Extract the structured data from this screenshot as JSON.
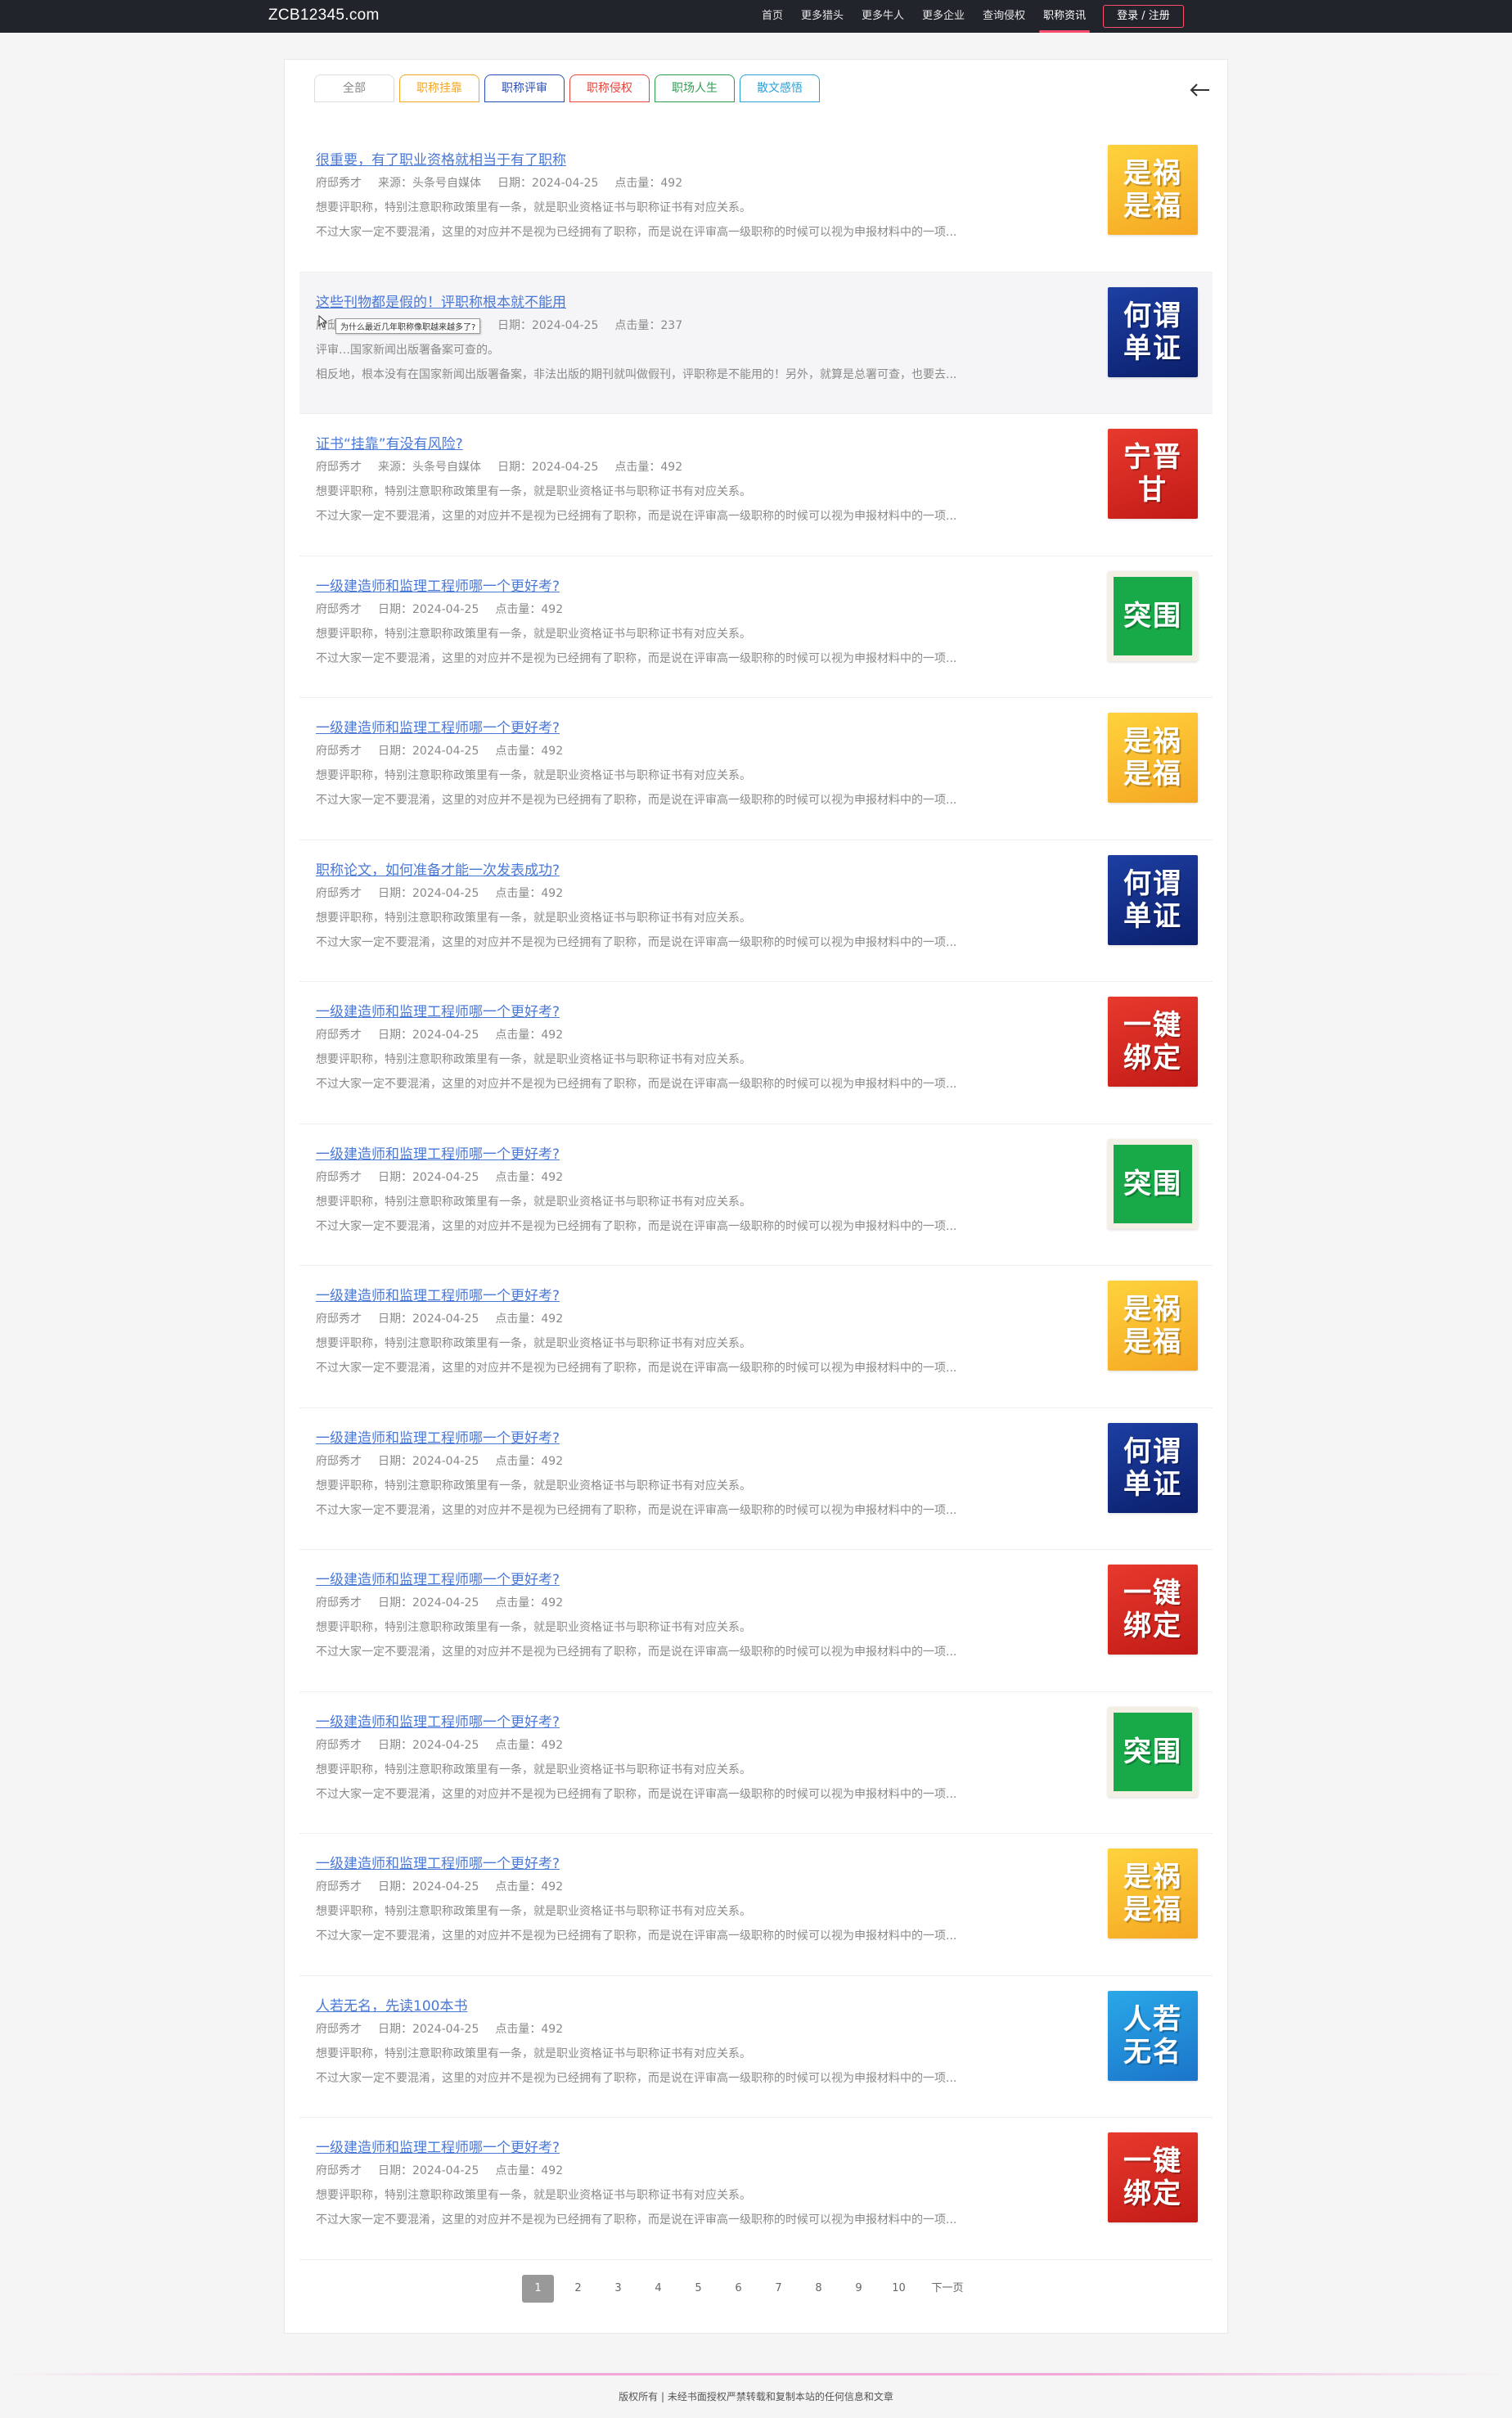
{
  "header": {
    "logo": "ZCB12345.com",
    "nav": [
      "首页",
      "更多猎头",
      "更多牛人",
      "更多企业",
      "查询侵权",
      "职称资讯"
    ],
    "active_nav": "职称资讯",
    "login_label": "登录 / 注册"
  },
  "tabs": [
    {
      "label": "全部",
      "color": "#888888"
    },
    {
      "label": "职称挂靠",
      "color": "#f5a623"
    },
    {
      "label": "职称评审",
      "color": "#2a4db8"
    },
    {
      "label": "职称侵权",
      "color": "#e8453c"
    },
    {
      "label": "职场人生",
      "color": "#2e9e4f"
    },
    {
      "label": "散文感悟",
      "color": "#2aa0d8"
    }
  ],
  "tooltip": "为什么最近几年职称像职越来越多了?",
  "articles": [
    {
      "title": "很重要，有了职业资格就相当于有了职称",
      "author": "府邸秀才",
      "source": "来源：头条号自媒体",
      "date": "日期：2024-04-25",
      "clicks": "点击量：492",
      "desc1": "想要评职称，特别注意职称政策里有一条，就是职业资格证书与职称证书有对应关系。",
      "desc2": "不过大家一定不要混淆，这里的对应并不是视为已经拥有了职称，而是说在评审高一级职称的时候可以视为申报材料中的一项...",
      "thumb_text": "是祸是福",
      "thumb_style": "yellow"
    },
    {
      "title": "这些刊物都是假的！评职称根本就不能用",
      "author": "府邸秀才",
      "source": "来源：头条号自媒体",
      "date": "日期：2024-04-25",
      "clicks": "点击量：237",
      "desc1": "评审…国家新闻出版署备案可查的。",
      "desc2": "相反地，根本没有在国家新闻出版署备案，非法出版的期刊就叫做假刊，评职称是不能用的！另外，就算是总署可查，也要去...",
      "thumb_text": "何谓单证",
      "thumb_style": "navy"
    },
    {
      "title": "证书“挂靠”有没有风险?",
      "author": "府邸秀才",
      "source": "来源：头条号自媒体",
      "date": "日期：2024-04-25",
      "clicks": "点击量：492",
      "desc1": "想要评职称，特别注意职称政策里有一条，就是职业资格证书与职称证书有对应关系。",
      "desc2": "不过大家一定不要混淆，这里的对应并不是视为已经拥有了职称，而是说在评审高一级职称的时候可以视为申报材料中的一项...",
      "thumb_text": "宁晋甘",
      "thumb_style": "red"
    },
    {
      "title": "一级建造师和监理工程师哪一个更好考?",
      "author": "府邸秀才",
      "source": "",
      "date": "日期：2024-04-25",
      "clicks": "点击量：492",
      "desc1": "想要评职称，特别注意职称政策里有一条，就是职业资格证书与职称证书有对应关系。",
      "desc2": "不过大家一定不要混淆，这里的对应并不是视为已经拥有了职称，而是说在评审高一级职称的时候可以视为申报材料中的一项...",
      "thumb_text": "突围",
      "thumb_style": "green"
    },
    {
      "title": "一级建造师和监理工程师哪一个更好考?",
      "author": "府邸秀才",
      "source": "",
      "date": "日期：2024-04-25",
      "clicks": "点击量：492",
      "desc1": "想要评职称，特别注意职称政策里有一条，就是职业资格证书与职称证书有对应关系。",
      "desc2": "不过大家一定不要混淆，这里的对应并不是视为已经拥有了职称，而是说在评审高一级职称的时候可以视为申报材料中的一项...",
      "thumb_text": "是祸是福",
      "thumb_style": "yellow"
    },
    {
      "title": "职称论文，如何准备才能一次发表成功?",
      "author": "府邸秀才",
      "source": "",
      "date": "日期：2024-04-25",
      "clicks": "点击量：492",
      "desc1": "想要评职称，特别注意职称政策里有一条，就是职业资格证书与职称证书有对应关系。",
      "desc2": "不过大家一定不要混淆，这里的对应并不是视为已经拥有了职称，而是说在评审高一级职称的时候可以视为申报材料中的一项...",
      "thumb_text": "何谓单证",
      "thumb_style": "navy"
    },
    {
      "title": "一级建造师和监理工程师哪一个更好考?",
      "author": "府邸秀才",
      "source": "",
      "date": "日期：2024-04-25",
      "clicks": "点击量：492",
      "desc1": "想要评职称，特别注意职称政策里有一条，就是职业资格证书与职称证书有对应关系。",
      "desc2": "不过大家一定不要混淆，这里的对应并不是视为已经拥有了职称，而是说在评审高一级职称的时候可以视为申报材料中的一项...",
      "thumb_text": "一键绑定",
      "thumb_style": "red"
    },
    {
      "title": "一级建造师和监理工程师哪一个更好考?",
      "author": "府邸秀才",
      "source": "",
      "date": "日期：2024-04-25",
      "clicks": "点击量：492",
      "desc1": "想要评职称，特别注意职称政策里有一条，就是职业资格证书与职称证书有对应关系。",
      "desc2": "不过大家一定不要混淆，这里的对应并不是视为已经拥有了职称，而是说在评审高一级职称的时候可以视为申报材料中的一项...",
      "thumb_text": "突围",
      "thumb_style": "green"
    },
    {
      "title": "一级建造师和监理工程师哪一个更好考?",
      "author": "府邸秀才",
      "source": "",
      "date": "日期：2024-04-25",
      "clicks": "点击量：492",
      "desc1": "想要评职称，特别注意职称政策里有一条，就是职业资格证书与职称证书有对应关系。",
      "desc2": "不过大家一定不要混淆，这里的对应并不是视为已经拥有了职称，而是说在评审高一级职称的时候可以视为申报材料中的一项...",
      "thumb_text": "是祸是福",
      "thumb_style": "yellow"
    },
    {
      "title": "一级建造师和监理工程师哪一个更好考?",
      "author": "府邸秀才",
      "source": "",
      "date": "日期：2024-04-25",
      "clicks": "点击量：492",
      "desc1": "想要评职称，特别注意职称政策里有一条，就是职业资格证书与职称证书有对应关系。",
      "desc2": "不过大家一定不要混淆，这里的对应并不是视为已经拥有了职称，而是说在评审高一级职称的时候可以视为申报材料中的一项...",
      "thumb_text": "何谓单证",
      "thumb_style": "navy"
    },
    {
      "title": "一级建造师和监理工程师哪一个更好考?",
      "author": "府邸秀才",
      "source": "",
      "date": "日期：2024-04-25",
      "clicks": "点击量：492",
      "desc1": "想要评职称，特别注意职称政策里有一条，就是职业资格证书与职称证书有对应关系。",
      "desc2": "不过大家一定不要混淆，这里的对应并不是视为已经拥有了职称，而是说在评审高一级职称的时候可以视为申报材料中的一项...",
      "thumb_text": "一键绑定",
      "thumb_style": "red"
    },
    {
      "title": "一级建造师和监理工程师哪一个更好考?",
      "author": "府邸秀才",
      "source": "",
      "date": "日期：2024-04-25",
      "clicks": "点击量：492",
      "desc1": "想要评职称，特别注意职称政策里有一条，就是职业资格证书与职称证书有对应关系。",
      "desc2": "不过大家一定不要混淆，这里的对应并不是视为已经拥有了职称，而是说在评审高一级职称的时候可以视为申报材料中的一项...",
      "thumb_text": "突围",
      "thumb_style": "green"
    },
    {
      "title": "一级建造师和监理工程师哪一个更好考?",
      "author": "府邸秀才",
      "source": "",
      "date": "日期：2024-04-25",
      "clicks": "点击量：492",
      "desc1": "想要评职称，特别注意职称政策里有一条，就是职业资格证书与职称证书有对应关系。",
      "desc2": "不过大家一定不要混淆，这里的对应并不是视为已经拥有了职称，而是说在评审高一级职称的时候可以视为申报材料中的一项...",
      "thumb_text": "是祸是福",
      "thumb_style": "yellow"
    },
    {
      "title": "人若无名，先读100本书",
      "author": "府邸秀才",
      "source": "",
      "date": "日期：2024-04-25",
      "clicks": "点击量：492",
      "desc1": "想要评职称，特别注意职称政策里有一条，就是职业资格证书与职称证书有对应关系。",
      "desc2": "不过大家一定不要混淆，这里的对应并不是视为已经拥有了职称，而是说在评审高一级职称的时候可以视为申报材料中的一项...",
      "thumb_text": "人若无名",
      "thumb_style": "blue"
    },
    {
      "title": "一级建造师和监理工程师哪一个更好考?",
      "author": "府邸秀才",
      "source": "",
      "date": "日期：2024-04-25",
      "clicks": "点击量：492",
      "desc1": "想要评职称，特别注意职称政策里有一条，就是职业资格证书与职称证书有对应关系。",
      "desc2": "不过大家一定不要混淆，这里的对应并不是视为已经拥有了职称，而是说在评审高一级职称的时候可以视为申报材料中的一项...",
      "thumb_text": "一键绑定",
      "thumb_style": "red"
    }
  ],
  "pagination": {
    "pages": [
      "1",
      "2",
      "3",
      "4",
      "5",
      "6",
      "7",
      "8",
      "9",
      "10"
    ],
    "current": "1",
    "next_label": "下一页"
  },
  "footer": {
    "text": "版权所有 | 未经书面授权严禁转载和复制本站的任何信息和文章"
  }
}
